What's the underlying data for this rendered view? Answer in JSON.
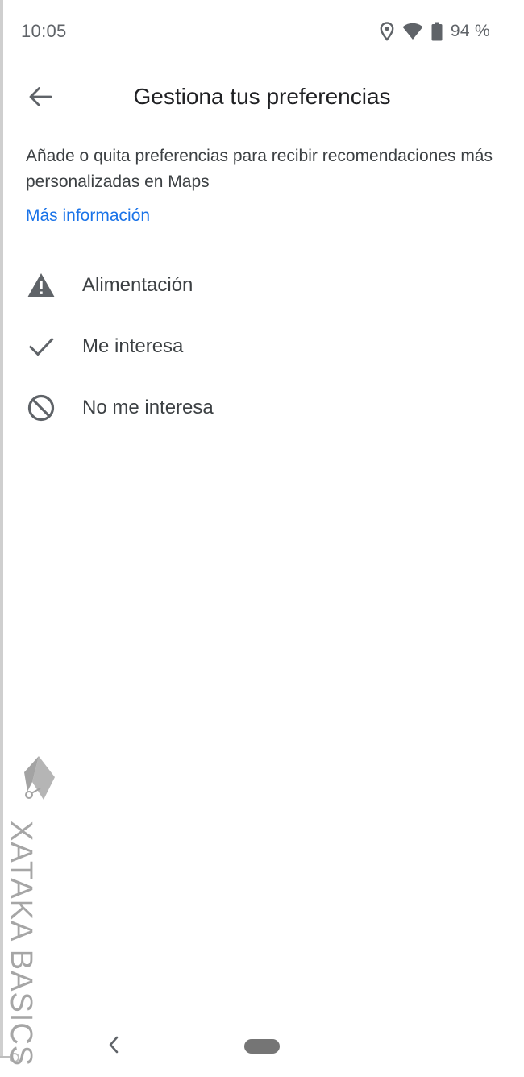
{
  "status_bar": {
    "time": "10:05",
    "battery_pct": "94 %",
    "icons": [
      "location-icon",
      "wifi-icon",
      "battery-icon"
    ]
  },
  "app_bar": {
    "back_icon": "arrow-back-icon",
    "title": "Gestiona tus preferencias"
  },
  "description": "Añade o quita preferencias para recibir recomendaciones más personalizadas en Maps",
  "more_info_link": "Más información",
  "preferences": [
    {
      "label": "Alimentación",
      "icon": "warning-icon"
    },
    {
      "label": "Me interesa",
      "icon": "check-icon"
    },
    {
      "label": "No me interesa",
      "icon": "block-icon"
    }
  ],
  "watermark": {
    "text": "XATAKA BASICS",
    "logo": "xataka-logo"
  },
  "nav_bar": {
    "back_icon": "chevron-left-icon",
    "home_icon": "home-pill-icon"
  },
  "colors": {
    "link": "#1a73e8",
    "text_primary": "#202124",
    "text_secondary": "#3c4043",
    "icon": "#5f6368"
  }
}
